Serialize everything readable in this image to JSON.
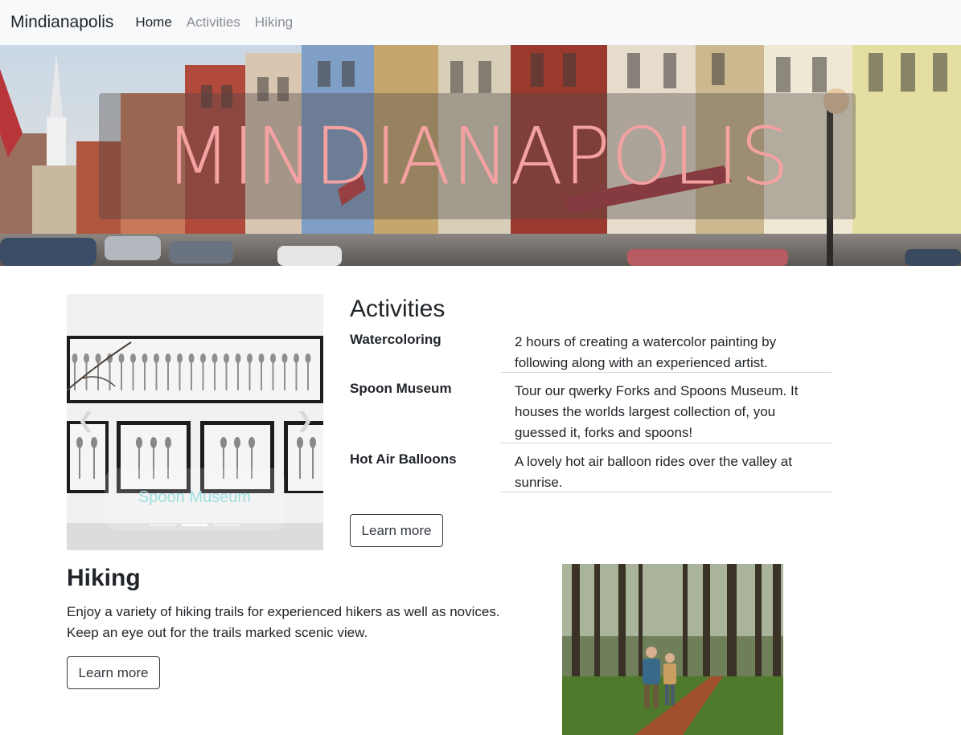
{
  "navbar": {
    "brand": "Mindianapolis",
    "links": [
      {
        "label": "Home",
        "active": true
      },
      {
        "label": "Activities",
        "active": false
      },
      {
        "label": "Hiking",
        "active": false
      }
    ]
  },
  "hero": {
    "title": "MINDIANAPOLIS",
    "title_color": "#f3a1a1"
  },
  "carousel": {
    "caption": "Spoon Museum",
    "prev_icon": "chevron-left-icon",
    "next_icon": "chevron-right-icon",
    "indicators": 3,
    "active_indicator": 2
  },
  "activities": {
    "title": "Activities",
    "items": [
      {
        "name": "Watercoloring",
        "description": "2 hours of creating a watercolor painting by following along with an experienced artist."
      },
      {
        "name": "Spoon Museum",
        "description": "Tour our qwerky Forks and Spoons Museum. It houses the worlds largest collection of, you guessed it, forks and spoons!"
      },
      {
        "name": "Hot Air Balloons",
        "description": "A lovely hot air balloon rides over the valley at sunrise."
      }
    ],
    "button_label": "Learn more"
  },
  "hiking": {
    "title": "Hiking",
    "description": "Enjoy a variety of hiking trails for experienced hikers as well as novices. Keep an eye out for the trails marked scenic view.",
    "button_label": "Learn more"
  }
}
